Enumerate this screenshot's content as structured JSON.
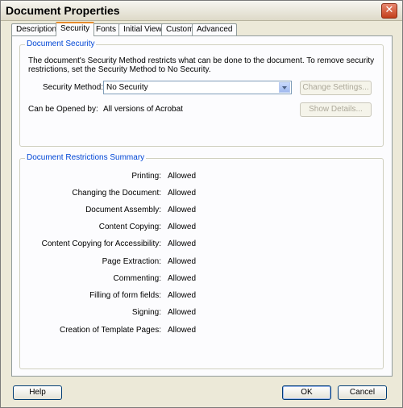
{
  "window": {
    "title": "Document Properties"
  },
  "tabs": [
    {
      "label": "Description"
    },
    {
      "label": "Security"
    },
    {
      "label": "Fonts"
    },
    {
      "label": "Initial View"
    },
    {
      "label": "Custom"
    },
    {
      "label": "Advanced"
    }
  ],
  "active_tab": "Security",
  "security": {
    "legend": "Document Security",
    "description_line1": "The document's Security Method restricts what can be done to the document. To remove security",
    "description_line2": "restrictions, set the Security Method to No Security.",
    "method_label": "Security Method:",
    "method_value": "No Security",
    "change_settings": "Change Settings...",
    "opened_label": "Can be Opened by:",
    "opened_value": "All versions of Acrobat",
    "show_details": "Show Details..."
  },
  "restrictions": {
    "legend": "Document Restrictions Summary",
    "rows": [
      {
        "label": "Printing:",
        "value": "Allowed"
      },
      {
        "label": "Changing the Document:",
        "value": "Allowed"
      },
      {
        "label": "Document Assembly:",
        "value": "Allowed"
      },
      {
        "label": "Content Copying:",
        "value": "Allowed"
      },
      {
        "label": "Content Copying for Accessibility:",
        "value": "Allowed"
      },
      {
        "label": "Page Extraction:",
        "value": "Allowed"
      },
      {
        "label": "Commenting:",
        "value": "Allowed"
      },
      {
        "label": "Filling of form fields:",
        "value": "Allowed"
      },
      {
        "label": "Signing:",
        "value": "Allowed"
      },
      {
        "label": "Creation of Template Pages:",
        "value": "Allowed"
      }
    ]
  },
  "footer": {
    "help": "Help",
    "ok": "OK",
    "cancel": "Cancel"
  },
  "colors": {
    "accent": "#0046d5",
    "tab_highlight": "#e68b2c",
    "close_button": "#c3401c"
  }
}
